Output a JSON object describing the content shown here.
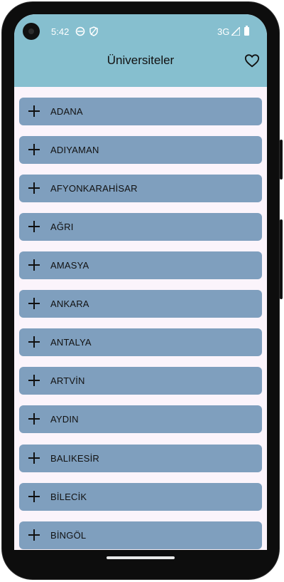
{
  "status": {
    "time": "5:42",
    "network": "3G"
  },
  "appbar": {
    "title": "Üniversiteler"
  },
  "cities": [
    "ADANA",
    "ADIYAMAN",
    "AFYONKARAHİSAR",
    "AĞRI",
    "AMASYA",
    "ANKARA",
    "ANTALYA",
    "ARTVİN",
    "AYDIN",
    "BALIKESİR",
    "BİLECİK",
    "BİNGÖL"
  ]
}
